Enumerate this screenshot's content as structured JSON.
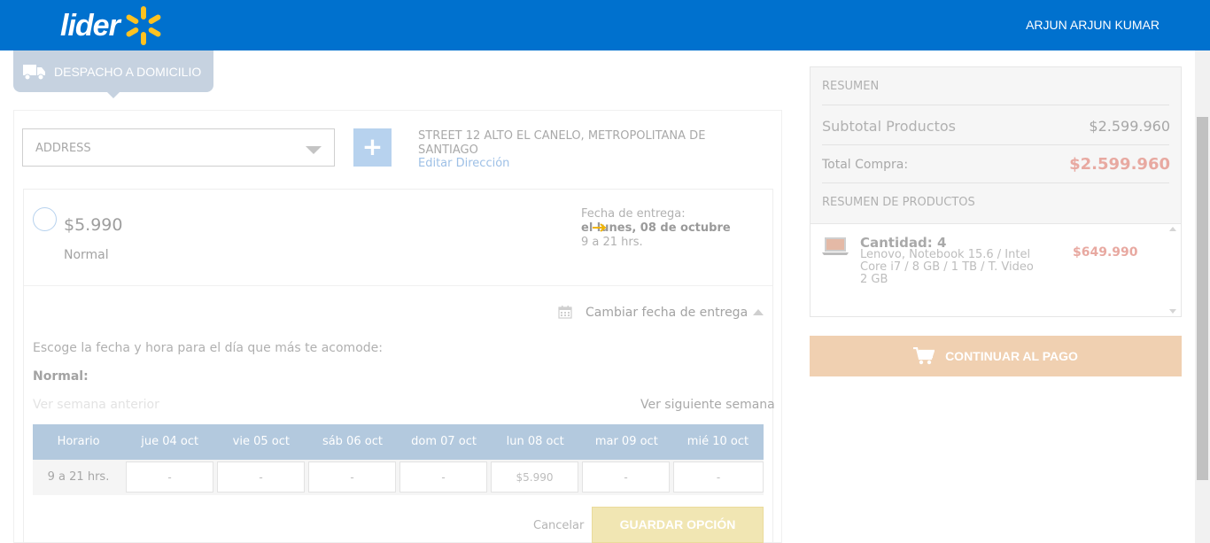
{
  "header": {
    "logo_text": "lider",
    "user_name": "ARJUN  ARJUN KUMAR"
  },
  "shipping_tab": {
    "label": "DESPACHO A DOMICILIO",
    "icon": "truck-icon"
  },
  "address": {
    "select_value": "ADDRESS",
    "add_button_label": "+",
    "full_address": "STREET 12 ALTO EL CANELO, METROPOLITANA DE SANTIAGO",
    "edit_link": "Editar Dirección"
  },
  "delivery_option": {
    "price": "$5.990",
    "name": "Normal",
    "date_label": "Fecha de entrega:",
    "date_value": "el lunes, 08 de octubre",
    "hours": "9 a 21 hrs."
  },
  "change_date": {
    "label": "Cambiar fecha de entrega",
    "instructions": "Escoge la fecha y hora para el día que más te acomode:",
    "type_label": "Normal:",
    "prev_week": "Ver semana anterior",
    "next_week": "Ver siguiente semana"
  },
  "schedule": {
    "columns": [
      "Horario",
      "jue 04 oct",
      "vie 05 oct",
      "sáb 06 oct",
      "dom 07 oct",
      "lun 08 oct",
      "mar 09 oct",
      "mié 10 oct"
    ],
    "row_label": "9 a 21 hrs.",
    "slots": [
      "-",
      "-",
      "-",
      "-",
      "$5.990",
      "-",
      "-"
    ]
  },
  "actions": {
    "cancel": "Cancelar",
    "save": "GUARDAR OPCIÓN"
  },
  "summary": {
    "title": "RESUMEN",
    "subtotal_label": "Subtotal Productos",
    "subtotal_value": "$2.599.960",
    "total_label": "Total Compra:",
    "total_value": "$2.599.960",
    "products_title": "RESUMEN DE PRODUCTOS",
    "product": {
      "quantity": "Cantidad: 4",
      "description": "Lenovo, Notebook 15.6 / Intel Core i7 / 8 GB / 1 TB / T. Video 2 GB",
      "price": "$649.990"
    }
  },
  "checkout": {
    "label": "CONTINUAR AL PAGO",
    "icon": "cart-icon"
  },
  "colors": {
    "brand_blue": "#0071ce",
    "spark_yellow": "#ffc220",
    "total_accent": "#e8a9a1",
    "checkout_button": "#f0d0b1"
  }
}
